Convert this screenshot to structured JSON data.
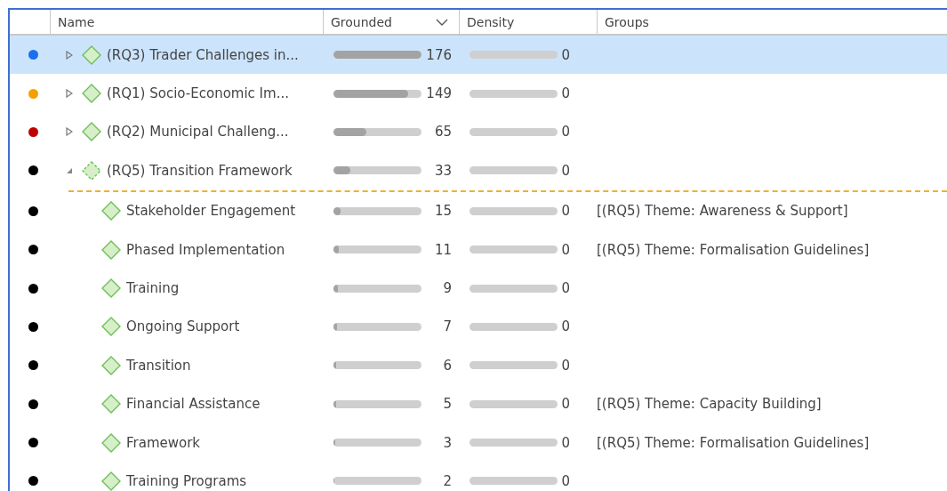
{
  "table": {
    "columns": [
      {
        "label": "Name"
      },
      {
        "label": "Grounded",
        "sorted": true
      },
      {
        "label": "Density"
      },
      {
        "label": "Groups"
      }
    ],
    "rows": [
      {
        "color": "#1a6ff0",
        "name": "(RQ3) Trader Challenges in...",
        "expanded": false,
        "selected": true,
        "grounded": {
          "text": "176",
          "level": 1
        },
        "density": {
          "text": "0",
          "level": 0
        }
      },
      {
        "color": "#f5a000",
        "name": "(RQ1) Socio-Economic Im...",
        "expanded": false,
        "selected": false,
        "grounded": {
          "text": "149",
          "level": 0.85
        },
        "density": {
          "text": "0",
          "level": 0
        }
      },
      {
        "color": "#c00000",
        "name": "(RQ2) Municipal Challeng...",
        "expanded": false,
        "selected": false,
        "grounded": {
          "text": "65",
          "level": 0.37
        },
        "density": {
          "text": "0",
          "level": 0
        }
      },
      {
        "color": "#000000",
        "name": "(RQ5) Transition Framework",
        "expanded": true,
        "selected": false,
        "grounded": {
          "text": "33",
          "level": 0.19
        },
        "density": {
          "text": "0",
          "level": 0
        },
        "children": [
          {
            "color": "#000000",
            "name": "Stakeholder Engagement",
            "selected": false,
            "grounded": {
              "text": "15",
              "level": 0.085
            },
            "density": {
              "text": "0",
              "level": 0
            },
            "groups": "[(RQ5) Theme: Awareness & Support]"
          },
          {
            "color": "#000000",
            "name": "Phased Implementation",
            "selected": false,
            "grounded": {
              "text": "11",
              "level": 0.06
            },
            "density": {
              "text": "0",
              "level": 0
            },
            "groups": "[(RQ5) Theme: Formalisation Guidelines]"
          },
          {
            "color": "#000000",
            "name": "Training",
            "selected": false,
            "grounded": {
              "text": "9",
              "level": 0.05
            },
            "density": {
              "text": "0",
              "level": 0
            }
          },
          {
            "color": "#000000",
            "name": "Ongoing Support",
            "selected": false,
            "grounded": {
              "text": "7",
              "level": 0.04
            },
            "density": {
              "text": "0",
              "level": 0
            }
          },
          {
            "color": "#000000",
            "name": "Transition",
            "selected": false,
            "grounded": {
              "text": "6",
              "level": 0.034
            },
            "density": {
              "text": "0",
              "level": 0
            }
          },
          {
            "color": "#000000",
            "name": "Financial Assistance",
            "selected": false,
            "grounded": {
              "text": "5",
              "level": 0.028
            },
            "density": {
              "text": "0",
              "level": 0
            },
            "groups": "[(RQ5) Theme: Capacity Building]"
          },
          {
            "color": "#000000",
            "name": "Framework",
            "selected": false,
            "grounded": {
              "text": "3",
              "level": 0.017
            },
            "density": {
              "text": "0",
              "level": 0
            },
            "groups": "[(RQ5) Theme: Formalisation Guidelines]"
          },
          {
            "color": "#000000",
            "name": "Training Programs",
            "selected": false,
            "grounded": {
              "text": "2",
              "level": 0.011
            },
            "density": {
              "text": "0",
              "level": 0
            }
          }
        ]
      }
    ]
  }
}
